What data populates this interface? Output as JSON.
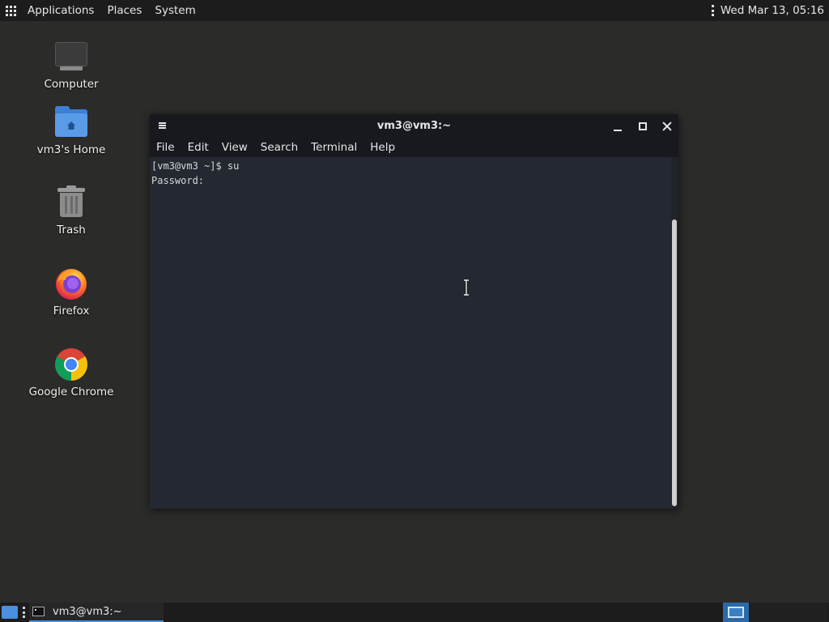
{
  "top_panel": {
    "menus": [
      "Applications",
      "Places",
      "System"
    ],
    "clock": "Wed Mar 13, 05:16"
  },
  "desktop": {
    "icons": [
      {
        "label": "Computer",
        "icon": "computer-icon"
      },
      {
        "label": "vm3's Home",
        "icon": "home-folder-icon"
      },
      {
        "label": "Trash",
        "icon": "trash-icon"
      },
      {
        "label": "Firefox",
        "icon": "firefox-icon"
      },
      {
        "label": "Google Chrome",
        "icon": "chrome-icon"
      }
    ]
  },
  "terminal": {
    "title": "vm3@vm3:~",
    "menu": [
      "File",
      "Edit",
      "View",
      "Search",
      "Terminal",
      "Help"
    ],
    "lines": [
      "[vm3@vm3 ~]$ su",
      "Password:"
    ]
  },
  "taskbar": {
    "task_label": "vm3@vm3:~",
    "workspaces": 4,
    "active_workspace": 1
  },
  "colors": {
    "desktop_bg": "#2b2b29",
    "panel_bg": "#1c1c1c",
    "terminal_bg": "#242830",
    "accent": "#3d8ee6"
  }
}
